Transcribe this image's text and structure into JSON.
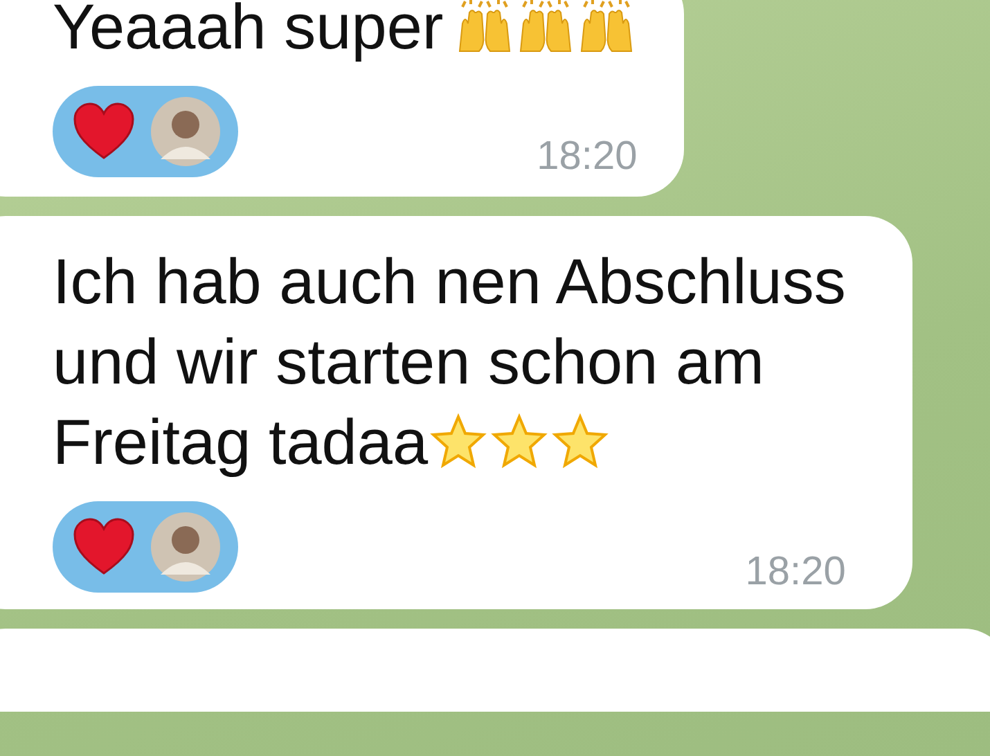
{
  "messages": [
    {
      "lines": [
        "Yeaaah super"
      ],
      "emoji": [
        {
          "kind": "hands"
        },
        {
          "kind": "hands"
        },
        {
          "kind": "hands"
        }
      ],
      "reaction": {
        "kind": "heart"
      },
      "time": "18:20"
    },
    {
      "lines": [
        "Ich hab auch nen Abschluss",
        "und wir starten schon am",
        "Freitag tadaa"
      ],
      "emoji": [
        {
          "kind": "star"
        },
        {
          "kind": "star"
        },
        {
          "kind": "star"
        }
      ],
      "reaction": {
        "kind": "heart"
      },
      "time": "18:20"
    }
  ]
}
